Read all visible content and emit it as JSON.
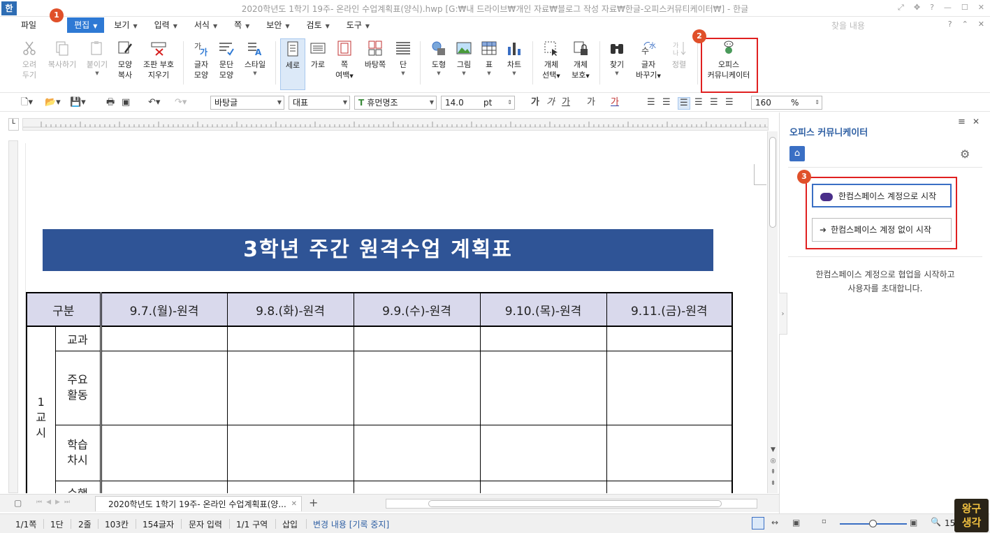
{
  "window": {
    "app_icon": "한",
    "title": "2020학년도 1학기 19주- 온라인 수업계획표(양식).hwp [G:₩내 드라이브₩개인 자료₩블로그 작성 자료₩한글-오피스커뮤티케이터₩] - 한글",
    "controls": [
      "⤢",
      "✥",
      "?",
      "—",
      "☐",
      "✕"
    ]
  },
  "menu": {
    "items": [
      {
        "label": "파일",
        "dropdown": false
      },
      {
        "label": "편집",
        "dropdown": true
      },
      {
        "label": "보기",
        "dropdown": true
      },
      {
        "label": "입력",
        "dropdown": true
      },
      {
        "label": "서식",
        "dropdown": true
      },
      {
        "label": "쪽",
        "dropdown": true
      },
      {
        "label": "보안",
        "dropdown": true
      },
      {
        "label": "검토",
        "dropdown": true
      },
      {
        "label": "도구",
        "dropdown": true
      }
    ],
    "find_placeholder": "찾을 내용",
    "right_controls": [
      "?",
      "⌃",
      "✕"
    ]
  },
  "ribbon": {
    "cut": [
      "오려",
      "두기"
    ],
    "copy": "복사하기",
    "paste": "붙이기",
    "format_copy": [
      "모양",
      "복사"
    ],
    "clear_cursor": [
      "조판 부호",
      "지우기"
    ],
    "char_shape": [
      "글자",
      "모양"
    ],
    "para_shape": [
      "문단",
      "모양"
    ],
    "style": "스타일",
    "portrait": "세로",
    "landscape": "가로",
    "page_margin": [
      "쪽",
      "여백"
    ],
    "master_page": "바탕쪽",
    "columns": "단",
    "shape": "도형",
    "picture": "그림",
    "table": "표",
    "chart": "차트",
    "obj_select": [
      "개체",
      "선택"
    ],
    "obj_protect": [
      "개체",
      "보호"
    ],
    "find": "찾기",
    "replace": [
      "글자",
      "바꾸기"
    ],
    "sort": "정렬",
    "office_comm": [
      "오피스",
      "커뮤니케이터"
    ]
  },
  "format_toolbar": {
    "style_value": "바탕글",
    "lang_value": "대표",
    "font_value": "휴먼명조",
    "size_value": "14.0",
    "size_unit": "pt",
    "zoom_value": "160",
    "zoom_unit": "%",
    "char_buttons": [
      "가",
      "가",
      "가",
      "가",
      "가"
    ]
  },
  "document": {
    "title": "3학년 주간 원격수업 계획표",
    "table_header": [
      "구분",
      "9.7.(월)-원격",
      "9.8.(화)-원격",
      "9.9.(수)-원격",
      "9.10.(목)-원격",
      "9.11.(금)-원격"
    ],
    "period_label": "1\n교\n시",
    "rows": [
      "교과",
      "주요\n활동",
      "학습\n차시",
      "수행"
    ]
  },
  "tabs": {
    "doc_tab": "2020학년도 1학기 19주- 온라인 수업계획표(양...",
    "add": "+"
  },
  "status": {
    "page": "1/1쪽",
    "column": "1단",
    "line": "2줄",
    "col": "103칸",
    "chars": "154글자",
    "mode": "문자 입력",
    "section": "1/1 구역",
    "insert": "삽입",
    "track": "변경 내용 [기록 중지]",
    "zoom_partial": "15"
  },
  "panel": {
    "title": "오피스 커뮤니케이터",
    "btn_with_account": "한컴스페이스 계정으로 시작",
    "btn_without_account": "한컴스페이스 계정 없이 시작",
    "description": "한컴스페이스 계정으로 협업을 시작하고\n사용자를 초대합니다.",
    "menu_icon": "≡",
    "close_icon": "✕"
  },
  "annotations": {
    "badge1": "1",
    "badge2": "2",
    "badge3": "3"
  },
  "watermark": [
    "왕구",
    "생각"
  ],
  "colors": {
    "accent": "#2e79d4",
    "title_band": "#2f5496",
    "header_fill": "#d9d9ec",
    "annotation_red": "#e02020"
  }
}
